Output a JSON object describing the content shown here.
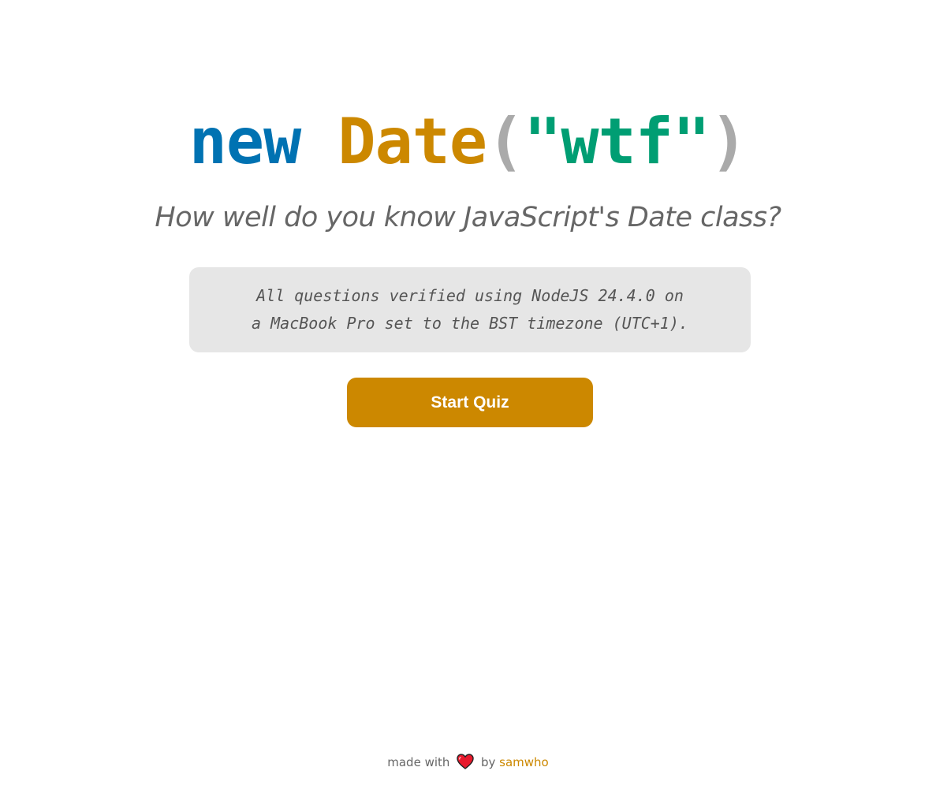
{
  "title": {
    "part_new": "new",
    "part_space": " ",
    "part_date": "Date",
    "part_open_paren": "(",
    "part_string": "\"wtf\"",
    "part_close_paren": ")"
  },
  "subtitle": "How well do you know JavaScript's Date class?",
  "notice": {
    "line1": "All questions verified using NodeJS 24.4.0 on",
    "line2": "a MacBook Pro set to the BST timezone (UTC+1)."
  },
  "start_button": {
    "label": "Start Quiz"
  },
  "footer": {
    "made_with": "made with",
    "heart_icon": "heart-icon",
    "by": "by",
    "author": "samwho"
  },
  "colors": {
    "keyword_blue": "#0072b2",
    "class_orange": "#cc8800",
    "paren_gray": "#aaaaaa",
    "string_green": "#009e73",
    "subtitle_gray": "#666666",
    "notice_bg": "#e6e6e6",
    "button_bg": "#cc8800",
    "heart_red": "#e8192c",
    "link_orange": "#cc8800"
  }
}
